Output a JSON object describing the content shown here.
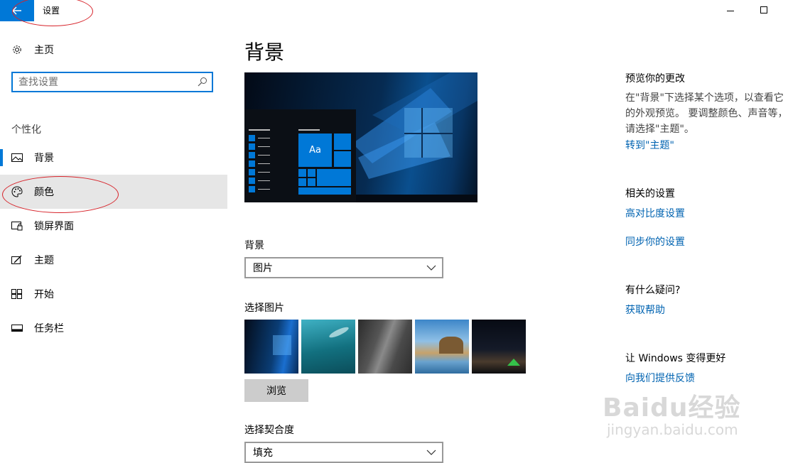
{
  "window": {
    "title": "设置",
    "back_icon": "arrow-left-icon"
  },
  "sidebar": {
    "home_label": "主页",
    "search_placeholder": "查找设置",
    "section_label": "个性化",
    "items": [
      {
        "label": "背景",
        "icon": "picture-icon",
        "active": true
      },
      {
        "label": "颜色",
        "icon": "palette-icon",
        "selected": true
      },
      {
        "label": "锁屏界面",
        "icon": "lock-screen-icon"
      },
      {
        "label": "主题",
        "icon": "theme-brush-icon"
      },
      {
        "label": "开始",
        "icon": "start-tiles-icon"
      },
      {
        "label": "任务栏",
        "icon": "taskbar-icon"
      }
    ]
  },
  "main": {
    "title": "背景",
    "preview_tile_text": "Aa",
    "background_label": "背景",
    "background_value": "图片",
    "choose_picture_label": "选择图片",
    "browse_label": "浏览",
    "fit_label": "选择契合度",
    "fit_value": "填充"
  },
  "right": {
    "preview_heading": "预览你的更改",
    "preview_text": "在\"背景\"下选择某个选项，以查看它的外观预览。 要调整颜色、声音等，请选择\"主题\"。",
    "theme_link": "转到\"主题\"",
    "related_heading": "相关的设置",
    "contrast_link": "高对比度设置",
    "sync_link": "同步你的设置",
    "questions_heading": "有什么疑问?",
    "help_link": "获取帮助",
    "improve_heading": "让 Windows 变得更好",
    "feedback_link": "向我们提供反馈"
  },
  "watermark": {
    "brand": "Baidu经验",
    "url": "jingyan.baidu.com"
  },
  "colors": {
    "accent": "#0078d7",
    "link": "#0063b1",
    "selected_bg": "#e6e6e6",
    "annotation": "#d7242b"
  }
}
